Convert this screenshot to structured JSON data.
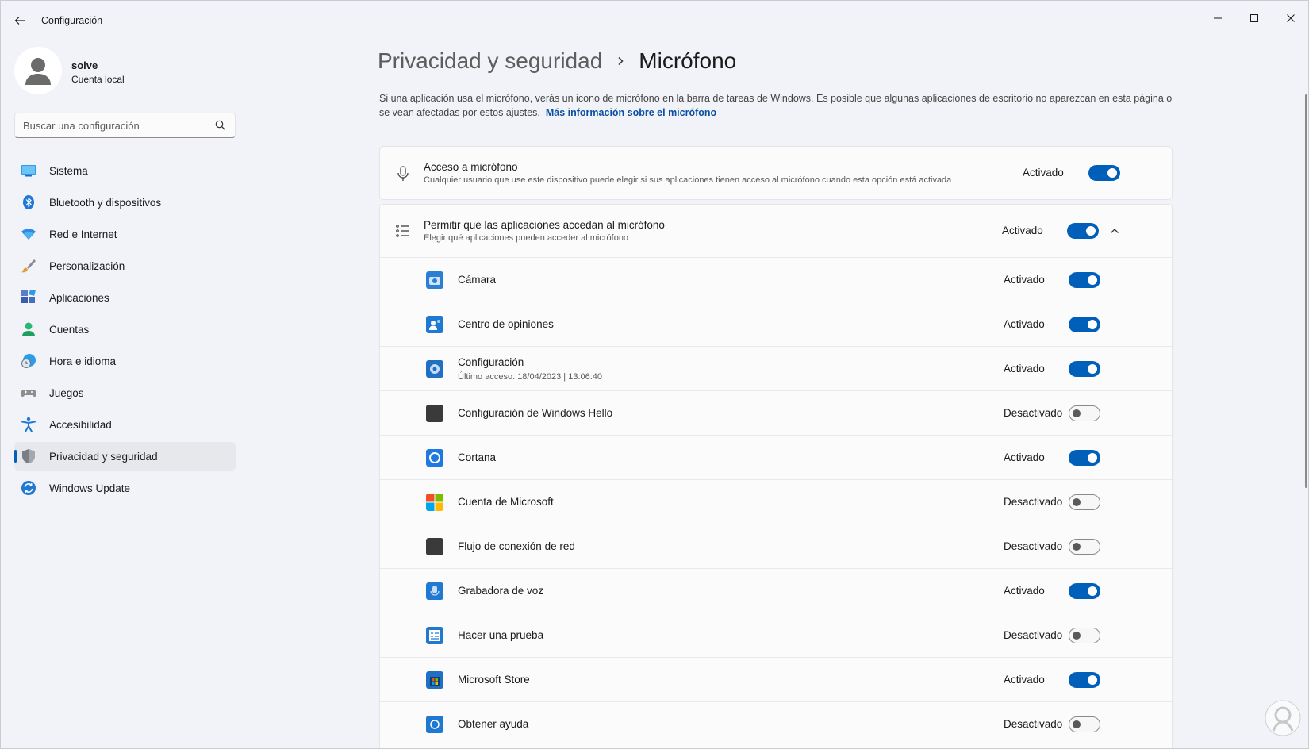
{
  "window": {
    "title": "Configuración",
    "back_icon": "back-arrow-icon",
    "controls": [
      "minimize-icon",
      "maximize-icon",
      "close-icon"
    ]
  },
  "profile": {
    "name": "solve",
    "account_type": "Cuenta local"
  },
  "search": {
    "placeholder": "Buscar una configuración"
  },
  "sidebar": {
    "items": [
      {
        "label": "Sistema",
        "icon": "system-icon"
      },
      {
        "label": "Bluetooth y dispositivos",
        "icon": "bluetooth-icon"
      },
      {
        "label": "Red e Internet",
        "icon": "wifi-icon"
      },
      {
        "label": "Personalización",
        "icon": "brush-icon"
      },
      {
        "label": "Aplicaciones",
        "icon": "apps-icon"
      },
      {
        "label": "Cuentas",
        "icon": "person-icon"
      },
      {
        "label": "Hora e idioma",
        "icon": "clock-globe-icon"
      },
      {
        "label": "Juegos",
        "icon": "gamepad-icon"
      },
      {
        "label": "Accesibilidad",
        "icon": "accessibility-icon"
      },
      {
        "label": "Privacidad y seguridad",
        "icon": "shield-icon",
        "active": true
      },
      {
        "label": "Windows Update",
        "icon": "update-icon"
      }
    ]
  },
  "main": {
    "breadcrumb_parent": "Privacidad y seguridad",
    "breadcrumb_current": "Micrófono",
    "description": "Si una aplicación usa el micrófono, verás un icono de micrófono en la barra de tareas de Windows. Es posible que algunas aplicaciones de escritorio no aparezcan en esta página o se vean afectadas por estos ajustes.",
    "more_info_link": "Más información sobre el micrófono",
    "mic_access": {
      "title": "Acceso a micrófono",
      "subtitle": "Cualquier usuario que use este dispositivo puede elegir si sus aplicaciones tienen acceso al micrófono cuando esta opción está activada",
      "state": "Activado",
      "on": true
    },
    "app_access": {
      "title": "Permitir que las aplicaciones accedan al micrófono",
      "subtitle": "Elegir qué aplicaciones pueden acceder al micrófono",
      "state": "Activado",
      "on": true
    },
    "apps": [
      {
        "name": "Cámara",
        "state": "Activado",
        "on": true,
        "icon": "camera-icon",
        "color": "#2a7fd4"
      },
      {
        "name": "Centro de opiniones",
        "state": "Activado",
        "on": true,
        "icon": "feedback-hub-icon",
        "color": "#1f78d1"
      },
      {
        "name": "Configuración",
        "sub": "Último acceso: 18/04/2023  |  13:06:40",
        "state": "Activado",
        "on": true,
        "icon": "settings-gear-icon",
        "color": "#1f6fc4"
      },
      {
        "name": "Configuración de Windows Hello",
        "state": "Desactivado",
        "on": false,
        "icon": "windows-hello-icon",
        "color": "#3a3a3a"
      },
      {
        "name": "Cortana",
        "state": "Activado",
        "on": true,
        "icon": "cortana-icon",
        "color": "#1e7ae0"
      },
      {
        "name": "Cuenta de Microsoft",
        "state": "Desactivado",
        "on": false,
        "icon": "microsoft-logo-icon",
        "color": "#f25022"
      },
      {
        "name": "Flujo de conexión de red",
        "state": "Desactivado",
        "on": false,
        "icon": "network-flow-icon",
        "color": "#3a3a3a"
      },
      {
        "name": "Grabadora de voz",
        "state": "Activado",
        "on": true,
        "icon": "voice-recorder-icon",
        "color": "#1f78d1"
      },
      {
        "name": "Hacer una prueba",
        "state": "Desactivado",
        "on": false,
        "icon": "take-a-test-icon",
        "color": "#1f78d1"
      },
      {
        "name": "Microsoft Store",
        "state": "Activado",
        "on": true,
        "icon": "store-icon",
        "color": "#1f6fc4"
      },
      {
        "name": "Obtener ayuda",
        "state": "Desactivado",
        "on": false,
        "icon": "get-help-icon",
        "color": "#1f78d1"
      }
    ]
  },
  "colors": {
    "accent": "#005fb8",
    "link": "#0a4fa2"
  }
}
